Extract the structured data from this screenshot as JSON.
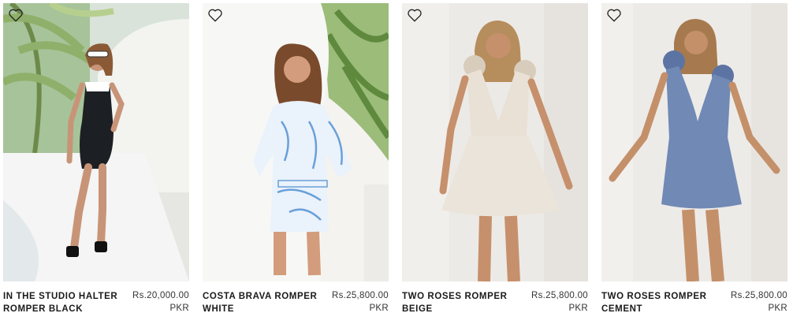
{
  "products": [
    {
      "name_line1": "IN THE STUDIO HALTER",
      "name_line2": "ROMPER BLACK",
      "price": "Rs.20,000.00",
      "currency": "PKR",
      "outfit_color": "#1c1f24",
      "accent_color": "#ffffff",
      "bg": "#eef0ee",
      "wishlist_icon": "heart-outline-icon"
    },
    {
      "name_line1": "COSTA BRAVA ROMPER",
      "name_line2": "WHITE",
      "price": "Rs.25,800.00",
      "currency": "PKR",
      "outfit_color": "#e8f1fb",
      "accent_color": "#6aa0d8",
      "bg": "#f4f3ef",
      "wishlist_icon": "heart-outline-icon"
    },
    {
      "name_line1": "TWO ROSES ROMPER",
      "name_line2": "BEIGE",
      "price": "Rs.25,800.00",
      "currency": "PKR",
      "outfit_color": "#e9e1d6",
      "accent_color": "#d8ccbc",
      "bg": "#eeeae6",
      "wishlist_icon": "heart-outline-icon"
    },
    {
      "name_line1": "TWO ROSES ROMPER",
      "name_line2": "CEMENT",
      "price": "Rs.25,800.00",
      "currency": "PKR",
      "outfit_color": "#7189b5",
      "accent_color": "#5c74a3",
      "bg": "#eeece9",
      "wishlist_icon": "heart-outline-icon"
    }
  ]
}
